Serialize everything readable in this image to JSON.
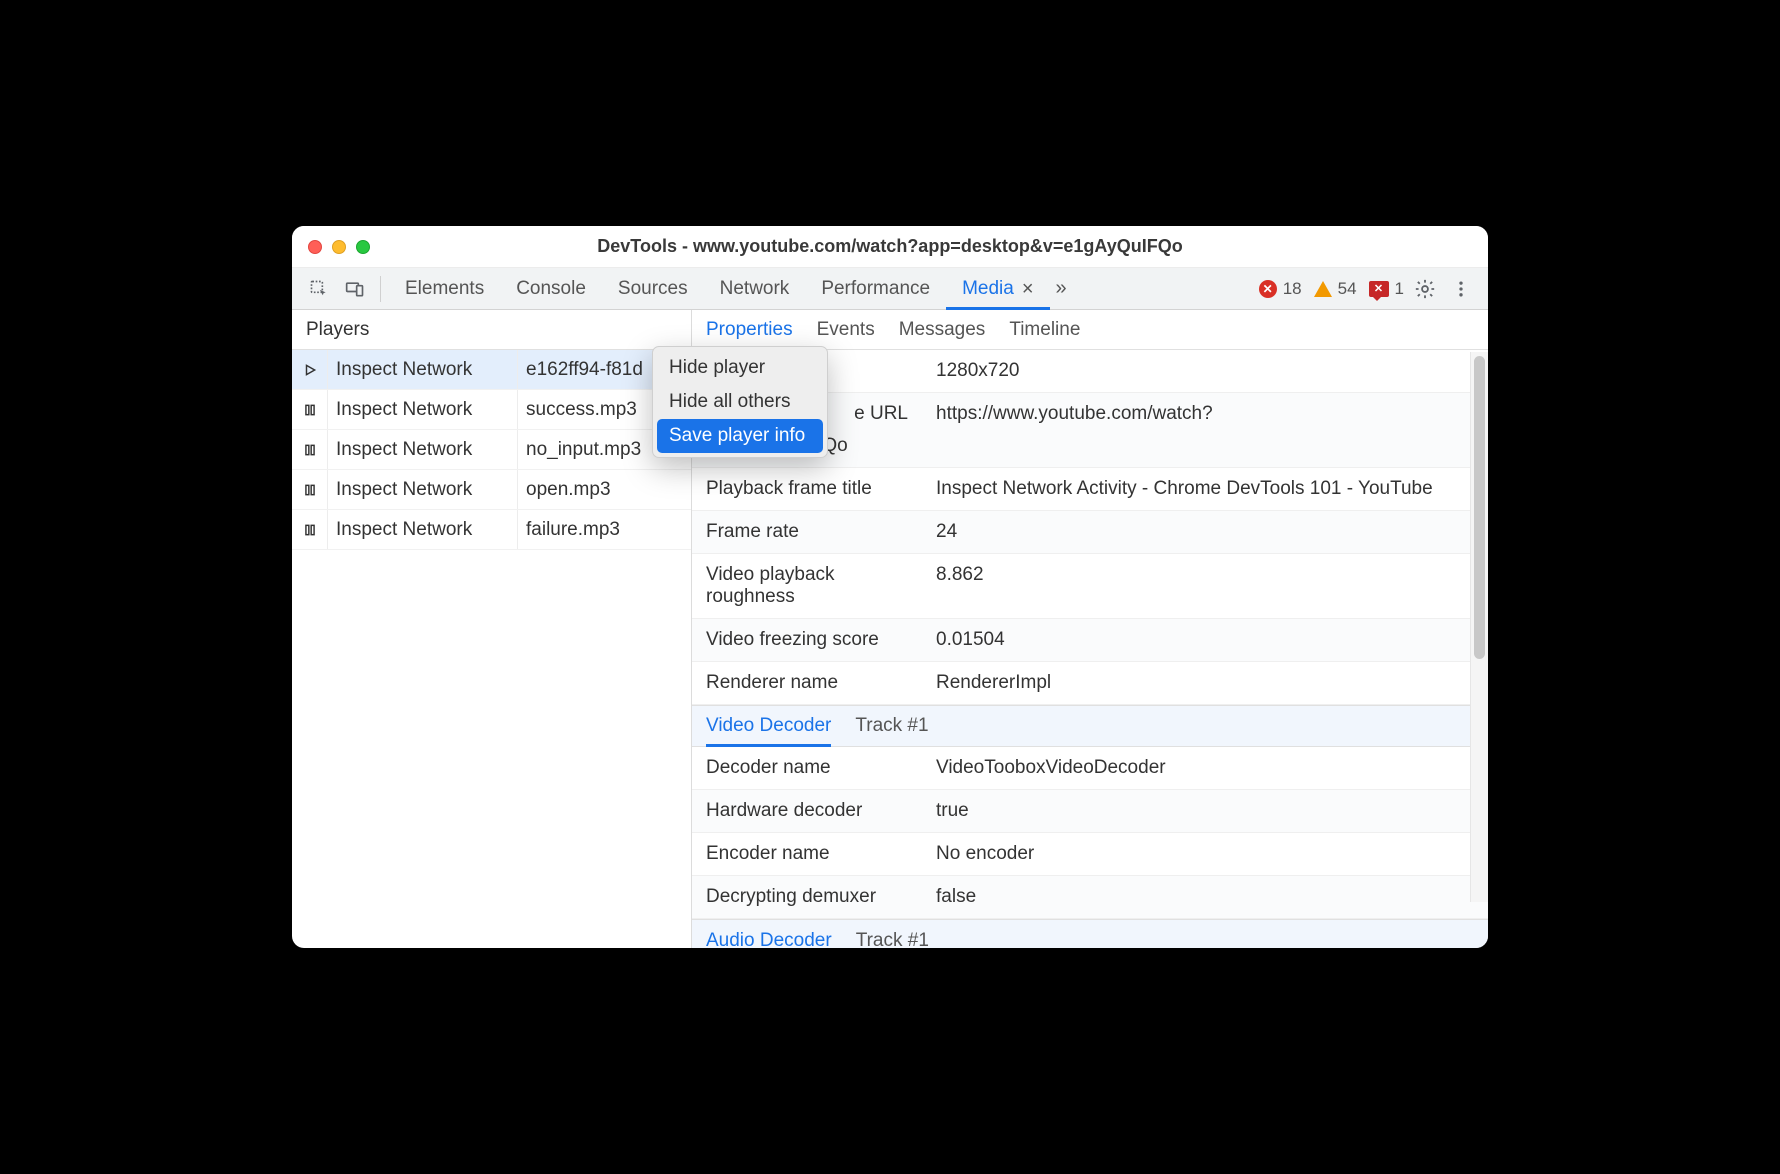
{
  "window": {
    "title": "DevTools - www.youtube.com/watch?app=desktop&v=e1gAyQuIFQo"
  },
  "toolbar": {
    "tabs": {
      "elements": "Elements",
      "console": "Console",
      "sources": "Sources",
      "network": "Network",
      "performance": "Performance",
      "media": "Media"
    },
    "counters": {
      "errors": "18",
      "warnings": "54",
      "issues": "1"
    }
  },
  "sidebar": {
    "header": "Players",
    "rows": [
      {
        "label": "Inspect Network",
        "file": "e162ff94-f81d"
      },
      {
        "label": "Inspect Network",
        "file": "success.mp3"
      },
      {
        "label": "Inspect Network",
        "file": "no_input.mp3"
      },
      {
        "label": "Inspect Network",
        "file": "open.mp3"
      },
      {
        "label": "Inspect Network",
        "file": "failure.mp3"
      }
    ]
  },
  "subtabs": {
    "properties": "Properties",
    "events": "Events",
    "messages": "Messages",
    "timeline": "Timeline"
  },
  "properties": {
    "visible_partial": "1280x720",
    "url_key_suffix": "e URL",
    "url_val_line1": "https://www.youtube.com/watch?",
    "url_val_line2": "v=e1gAyQuIFQo",
    "frame_title_key": "Playback frame title",
    "frame_title_val": "Inspect Network Activity - Chrome DevTools 101 - YouTube",
    "framerate_key": "Frame rate",
    "framerate_val": "24",
    "roughness_key": "Video playback roughness",
    "roughness_val": "8.862",
    "freezing_key": "Video freezing score",
    "freezing_val": "0.01504",
    "renderer_key": "Renderer name",
    "renderer_val": "RendererImpl"
  },
  "video_decoder": {
    "tab_label": "Video Decoder",
    "track_label": "Track #1",
    "decoder_name_key": "Decoder name",
    "decoder_name_val": "VideoTooboxVideoDecoder",
    "hw_key": "Hardware decoder",
    "hw_val": "true",
    "encoder_key": "Encoder name",
    "encoder_val": "No encoder",
    "demuxer_key": "Decrypting demuxer",
    "demuxer_val": "false"
  },
  "audio_decoder": {
    "tab_label": "Audio Decoder",
    "track_label": "Track #1"
  },
  "context_menu": {
    "hide_player": "Hide player",
    "hide_others": "Hide all others",
    "save_info": "Save player info"
  }
}
